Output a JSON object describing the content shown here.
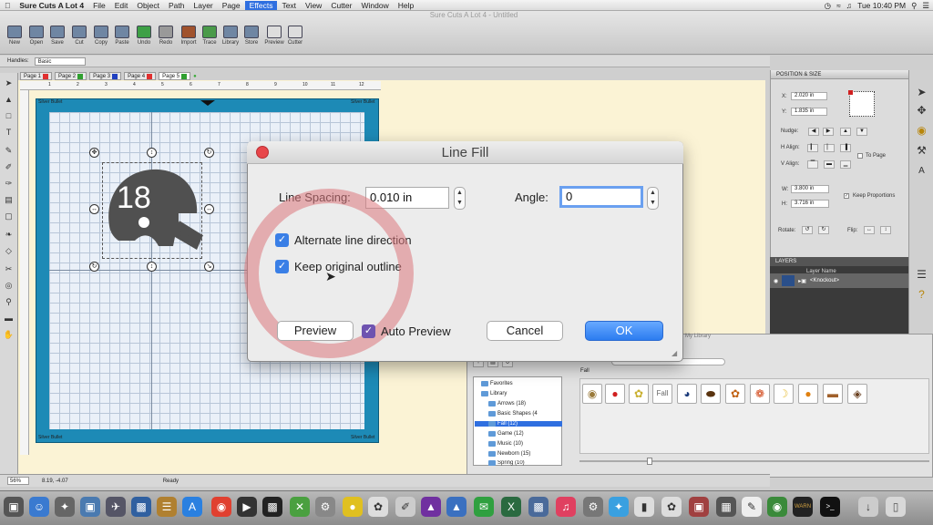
{
  "menubar": {
    "app": "Sure Cuts A Lot 4",
    "items": [
      "File",
      "Edit",
      "Object",
      "Path",
      "Layer",
      "Page",
      "Effects",
      "Text",
      "View",
      "Cutter",
      "Window",
      "Help"
    ],
    "selected": "Effects",
    "clock": "Tue 10:40 PM"
  },
  "window_title": "Sure Cuts A Lot 4 - Untitled",
  "toolbar": [
    "New",
    "Open",
    "Save",
    "Cut",
    "Copy",
    "Paste",
    "Undo",
    "Redo",
    "Import",
    "Trace",
    "Library",
    "Store",
    "Preview",
    "Cutter"
  ],
  "handlebar": {
    "label": "Handles:",
    "value": "Basic"
  },
  "pages": [
    {
      "label": "Page 1",
      "color": "#e03030"
    },
    {
      "label": "Page 2",
      "color": "#30a030"
    },
    {
      "label": "Page 3",
      "color": "#2040c0"
    },
    {
      "label": "Page 4",
      "color": "#e03030"
    },
    {
      "label": "Page 5",
      "color": "#30a030"
    }
  ],
  "ruler_ticks": [
    "1",
    "2",
    "3",
    "4",
    "5",
    "6",
    "7",
    "8",
    "9",
    "10",
    "11",
    "12"
  ],
  "mat": {
    "label": "Silver Bullet",
    "color": "#1d8ab6"
  },
  "design": {
    "number": "18"
  },
  "position_size": {
    "title": "POSITION & SIZE",
    "x_label": "X:",
    "x": "2.020 in",
    "y_label": "Y:",
    "y": "1.835 in",
    "nudge": "Nudge:",
    "h_align": "H Align:",
    "v_align": "V Align:",
    "to_page": "To Page",
    "w_label": "W:",
    "w": "3.800 in",
    "h_label": "H:",
    "h": "3.716 in",
    "keep_proportions": "Keep Proportions",
    "rotate": "Rotate:",
    "flip": "Flip:"
  },
  "layers": {
    "title": "LAYERS",
    "column": "Layer Name",
    "row": "<Knockout>"
  },
  "library": {
    "title": "My Library",
    "category": "Fall",
    "tree": [
      {
        "label": "Favorites",
        "level": 1
      },
      {
        "label": "Library",
        "level": 1
      },
      {
        "label": "Arrows (18)",
        "level": 2
      },
      {
        "label": "Basic Shapes (4",
        "level": 2
      },
      {
        "label": "Fall (12)",
        "level": 2,
        "selected": true
      },
      {
        "label": "Game (12)",
        "level": 2
      },
      {
        "label": "Music (10)",
        "level": 2
      },
      {
        "label": "Newborn (15)",
        "level": 2
      },
      {
        "label": "Spring (10)",
        "level": 2
      }
    ],
    "thumbs": [
      "acorn-icon",
      "apple-icon",
      "corn-icon",
      "fall-text-icon",
      "helmet-icon",
      "football-icon",
      "leaf-icon",
      "leaf-2-icon",
      "moon-icon",
      "pumpkin-icon",
      "turkey-dish-icon",
      "turkey-icon"
    ]
  },
  "status": {
    "zoom": "56%",
    "coords": "8.19, -4.07",
    "state": "Ready"
  },
  "dialog": {
    "title": "Line Fill",
    "line_spacing_label": "Line Spacing:",
    "line_spacing": "0.010 in",
    "angle_label": "Angle:",
    "angle": "0",
    "alternate_label": "Alternate line direction",
    "alternate_checked": true,
    "keep_outline_label": "Keep original outline",
    "keep_outline_checked": true,
    "preview_btn": "Preview",
    "auto_preview_label": "Auto Preview",
    "auto_preview_checked": true,
    "cancel_btn": "Cancel",
    "ok_btn": "OK"
  },
  "colors": {
    "accent": "#2b7cf0",
    "mat": "#1d8ab6",
    "workspace": "#fbf3d5",
    "close": "#e8464a"
  }
}
